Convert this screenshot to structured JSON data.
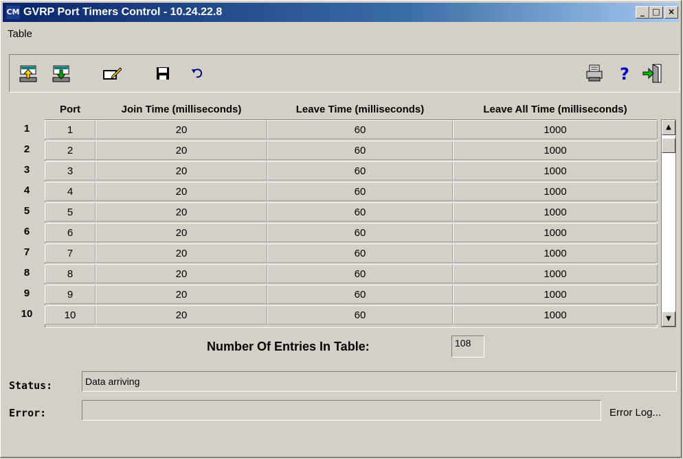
{
  "window": {
    "title": "GVRP Port Timers Control - 10.24.22.8",
    "app_icon": "CM",
    "minimize_glyph": "_",
    "maximize_glyph": "□",
    "close_glyph": "×"
  },
  "menu": [
    "Table"
  ],
  "toolbar": {
    "left_icons": [
      "upload-icon",
      "download-icon",
      "edit-icon",
      "save-icon",
      "undo-icon"
    ],
    "right_icons": [
      "print-icon",
      "help-icon",
      "exit-icon"
    ]
  },
  "table": {
    "columns": [
      "Port",
      "Join Time (milliseconds)",
      "Leave Time (milliseconds)",
      "Leave All Time (milliseconds)"
    ],
    "row_numbers": [
      "1",
      "2",
      "3",
      "4",
      "5",
      "6",
      "7",
      "8",
      "9",
      "10"
    ],
    "rows": [
      [
        "1",
        "20",
        "60",
        "1000"
      ],
      [
        "2",
        "20",
        "60",
        "1000"
      ],
      [
        "3",
        "20",
        "60",
        "1000"
      ],
      [
        "4",
        "20",
        "60",
        "1000"
      ],
      [
        "5",
        "20",
        "60",
        "1000"
      ],
      [
        "6",
        "20",
        "60",
        "1000"
      ],
      [
        "7",
        "20",
        "60",
        "1000"
      ],
      [
        "8",
        "20",
        "60",
        "1000"
      ],
      [
        "9",
        "20",
        "60",
        "1000"
      ],
      [
        "10",
        "20",
        "60",
        "1000"
      ]
    ]
  },
  "entries": {
    "label": "Number Of Entries In Table:",
    "value": "108"
  },
  "status": {
    "label": "Status:",
    "value": "Data arriving"
  },
  "error": {
    "label": "Error:",
    "value": "",
    "log_label": "Error Log..."
  }
}
